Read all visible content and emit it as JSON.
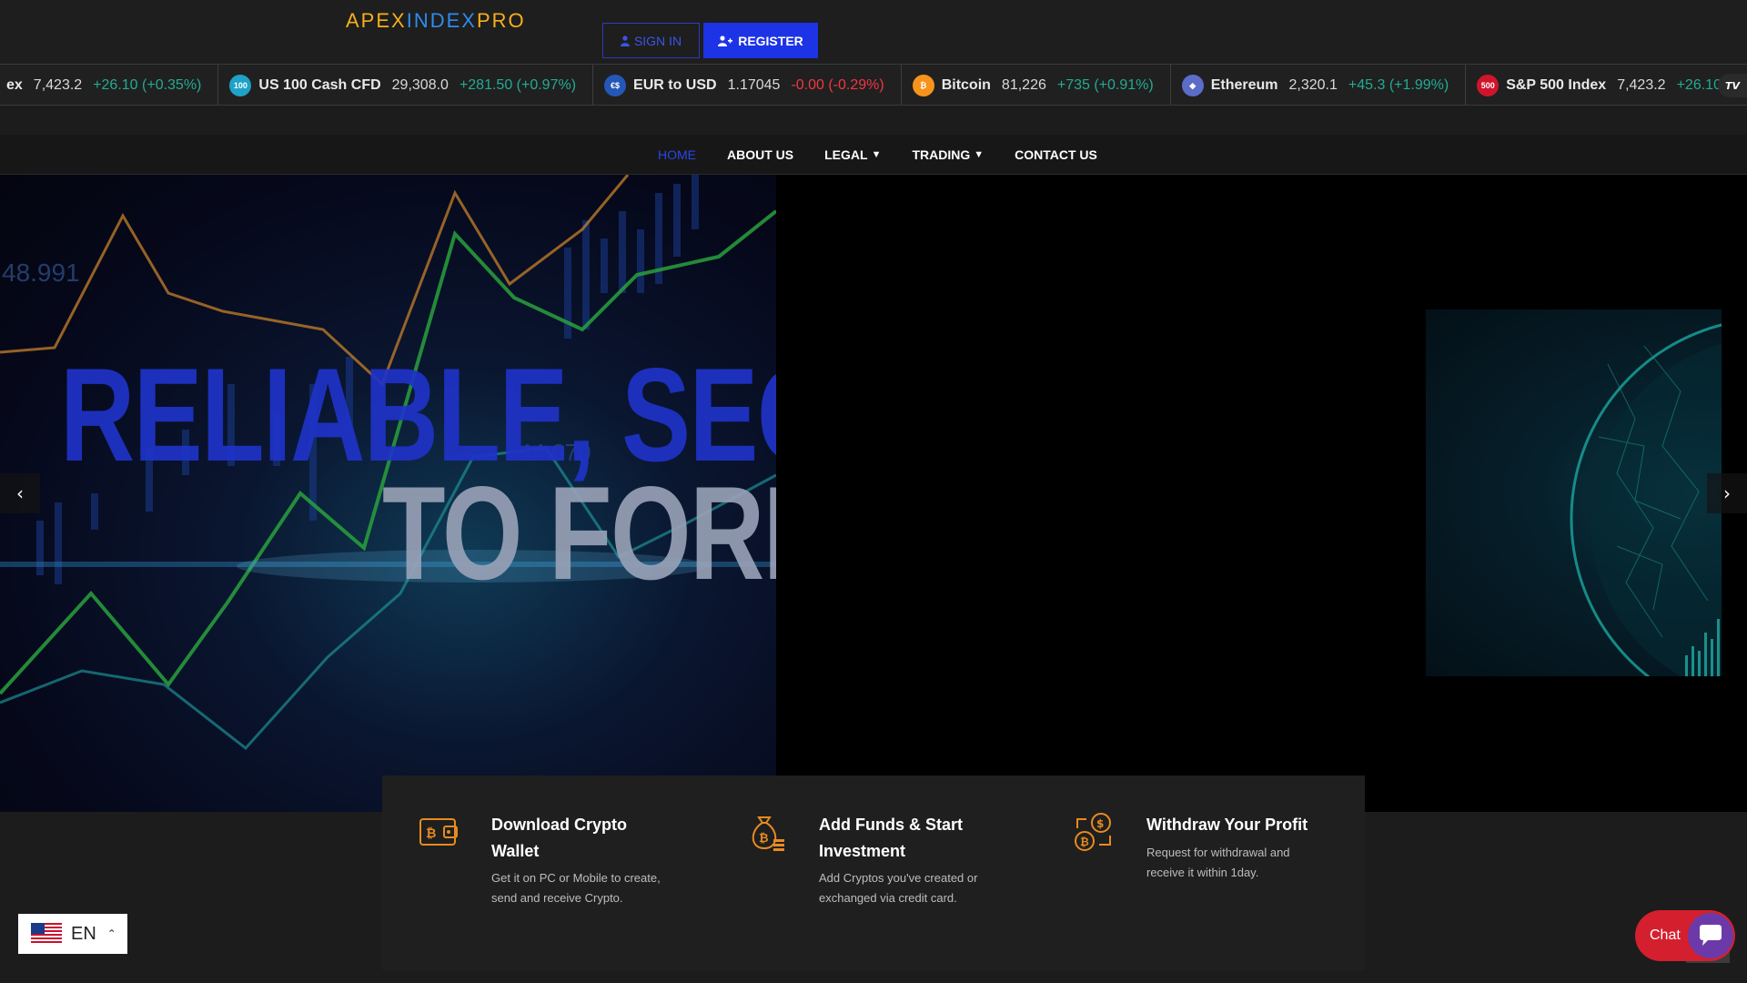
{
  "header": {
    "logo_apex": "APEX",
    "logo_index": "INDEX",
    "logo_pro": "PRO",
    "sign_in": "SIGN IN",
    "register": "REGISTER"
  },
  "ticker": [
    {
      "name": "ex",
      "price": "7,423.2",
      "change": "+26.10 (+0.35%)",
      "dir": "up",
      "icon_text": "",
      "icon_color": ""
    },
    {
      "name": "US 100 Cash CFD",
      "price": "29,308.0",
      "change": "+281.50 (+0.97%)",
      "dir": "up",
      "icon_text": "100",
      "icon_color": "#1ea2c6"
    },
    {
      "name": "EUR to USD",
      "price": "1.17045",
      "change": "-0.00 (-0.29%)",
      "dir": "down",
      "icon_text": "€$",
      "icon_color": "#2457b8"
    },
    {
      "name": "Bitcoin",
      "price": "81,226",
      "change": "+735 (+0.91%)",
      "dir": "up",
      "icon_text": "₿",
      "icon_color": "#f7931a"
    },
    {
      "name": "Ethereum",
      "price": "2,320.1",
      "change": "+45.3 (+1.99%)",
      "dir": "up",
      "icon_text": "◆",
      "icon_color": "#5b6cc9"
    },
    {
      "name": "S&P 500 Index",
      "price": "7,423.2",
      "change": "+26.10",
      "dir": "up",
      "icon_text": "500",
      "icon_color": "#d0142c"
    }
  ],
  "ticker_brand": "TV",
  "nav": {
    "home": "HOME",
    "about": "ABOUT US",
    "legal": "LEGAL",
    "trading": "TRADING",
    "contact": "CONTACT US"
  },
  "hero": {
    "line1": "RELIABLE, SECU",
    "line2": "TO FOREX",
    "number1": "48.991",
    "number2": "44.670"
  },
  "features": [
    {
      "title": "Download Crypto Wallet",
      "desc": "Get it on PC or Mobile to create, send and receive Crypto."
    },
    {
      "title": "Add Funds & Start Investment",
      "desc": "Add Cryptos you've created or exchanged via credit card."
    },
    {
      "title": "Withdraw Your Profit",
      "desc": "Request for withdrawal and receive it within 1day."
    }
  ],
  "language": {
    "code": "EN"
  },
  "chat": {
    "label": "Chat"
  }
}
